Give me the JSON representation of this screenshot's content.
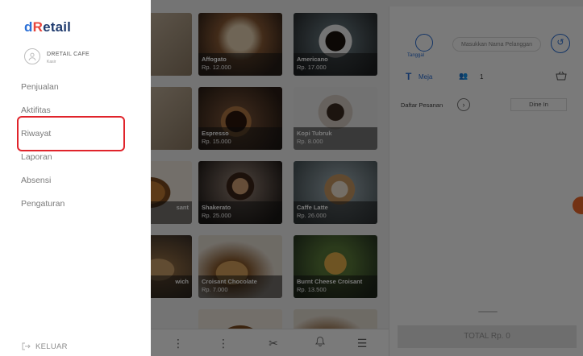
{
  "brand": {
    "logo_d": "d",
    "logo_R": "R",
    "logo_rest": "etail"
  },
  "user": {
    "name": "DRETAIL CAFE",
    "role": "Kasir"
  },
  "menu": [
    {
      "label": "Penjualan"
    },
    {
      "label": "Aktifitas"
    },
    {
      "label": "Riwayat"
    },
    {
      "label": "Laporan"
    },
    {
      "label": "Absensi"
    },
    {
      "label": "Pengaturan"
    }
  ],
  "logout_label": "KELUAR",
  "products": [
    {
      "name": "Affogato",
      "price": "Rp. 12.000"
    },
    {
      "name": "Americano",
      "price": "Rp. 17.000"
    },
    {
      "name": "Espresso",
      "price": "Rp. 15.000"
    },
    {
      "name": "Kopi Tubruk",
      "price": "Rp. 8.000"
    },
    {
      "name": "Shakerato",
      "price": "Rp. 25.000"
    },
    {
      "name": "Caffe Latte",
      "price": "Rp. 26.000"
    },
    {
      "name": "Croisant Chocolate",
      "price": "Rp. 7.000"
    },
    {
      "name": "Burnt Cheese Croisant",
      "price": "Rp. 13.500"
    }
  ],
  "partial_labels": {
    "sant": "sant",
    "wich": "wich"
  },
  "order": {
    "guest_label": "Tanggal",
    "customer_placeholder": "Masukkan Nama Pelanggan",
    "table_label": "Meja",
    "pax_value": "1",
    "order_list_label": "Daftar Pesanan",
    "dine_in_label": "Dine In",
    "total_label": "TOTAL Rp. 0"
  },
  "colors": {
    "accent": "#2a6fd6",
    "highlight": "#e0242b",
    "logo_red": "#e8453c"
  }
}
